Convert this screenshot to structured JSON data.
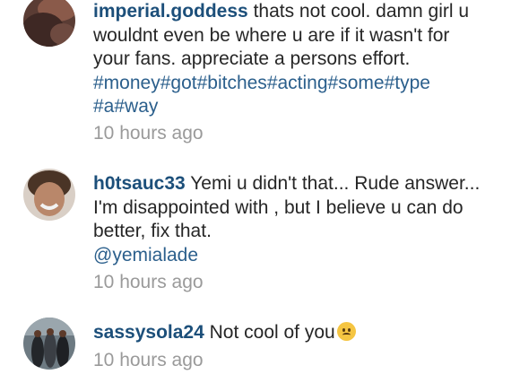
{
  "comments": [
    {
      "username": "imperial.goddess",
      "text": "thats not cool. damn girl u wouldnt even be where u are if it wasn't for your fans. appreciate a persons effort.",
      "hashtags": [
        "#money",
        "#got",
        "#bitches",
        "#acting",
        "#some",
        "#type",
        "#a",
        "#way"
      ],
      "time": "10 hours ago"
    },
    {
      "username": "h0tsauc33",
      "text": "Yemi u didn't that... Rude answer... I'm disappointed with , but I believe u can do better, fix that.",
      "mention": "@yemialade",
      "time": "10 hours ago"
    },
    {
      "username": "sassysola24",
      "text": "Not cool of you",
      "emoji": "worried-face-emoji",
      "time": "10 hours ago"
    }
  ]
}
